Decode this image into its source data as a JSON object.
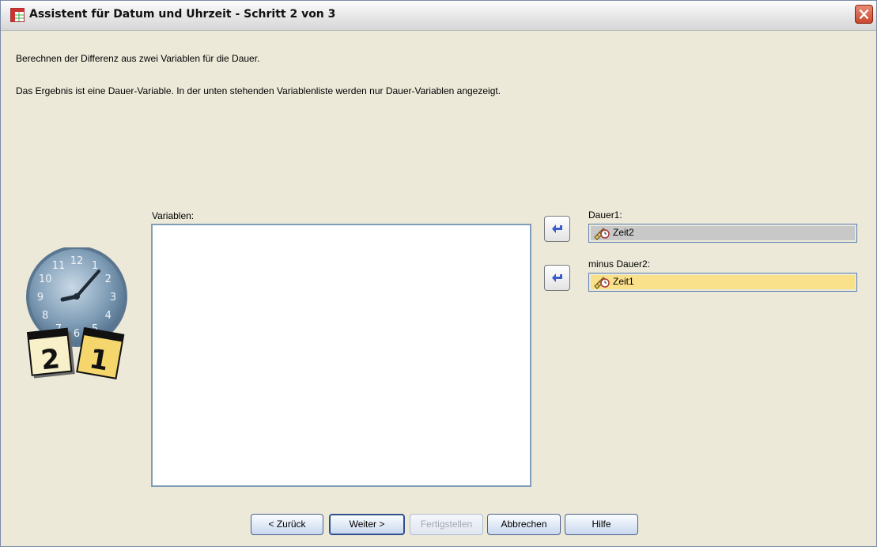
{
  "window": {
    "title": "Assistent für Datum und Uhrzeit - Schritt 2 von 3"
  },
  "instructions": {
    "line1": "Berechnen der Differenz aus zwei Variablen für die Dauer.",
    "line2": "Das Ergebnis ist eine Dauer-Variable. In der unten stehenden Variablenliste werden nur Dauer-Variablen angezeigt."
  },
  "variables": {
    "label": "Variablen:",
    "items": []
  },
  "dauer1": {
    "label": "Dauer1:",
    "value": "Zeit2"
  },
  "dauer2": {
    "label": "minus Dauer2:",
    "value": "Zeit1"
  },
  "buttons": {
    "back": "< Zurück",
    "next": "Weiter >",
    "finish": "Fertigstellen",
    "cancel": "Abbrechen",
    "help": "Hilfe"
  },
  "calendar": {
    "page_left": "2",
    "page_right": "1"
  },
  "clock_numbers": [
    "12",
    "1",
    "2",
    "3",
    "4",
    "5",
    "6",
    "7",
    "8",
    "9",
    "10",
    "11"
  ],
  "icons": [
    "app-grid-icon",
    "close-icon",
    "move-left-arrow-icon",
    "duration-variable-icon",
    "clock-calendar-icon"
  ],
  "colors": {
    "selected_field": "#f9e08a",
    "filled_field": "#c8c8c8",
    "accent_blue": "#3b5cc8"
  }
}
